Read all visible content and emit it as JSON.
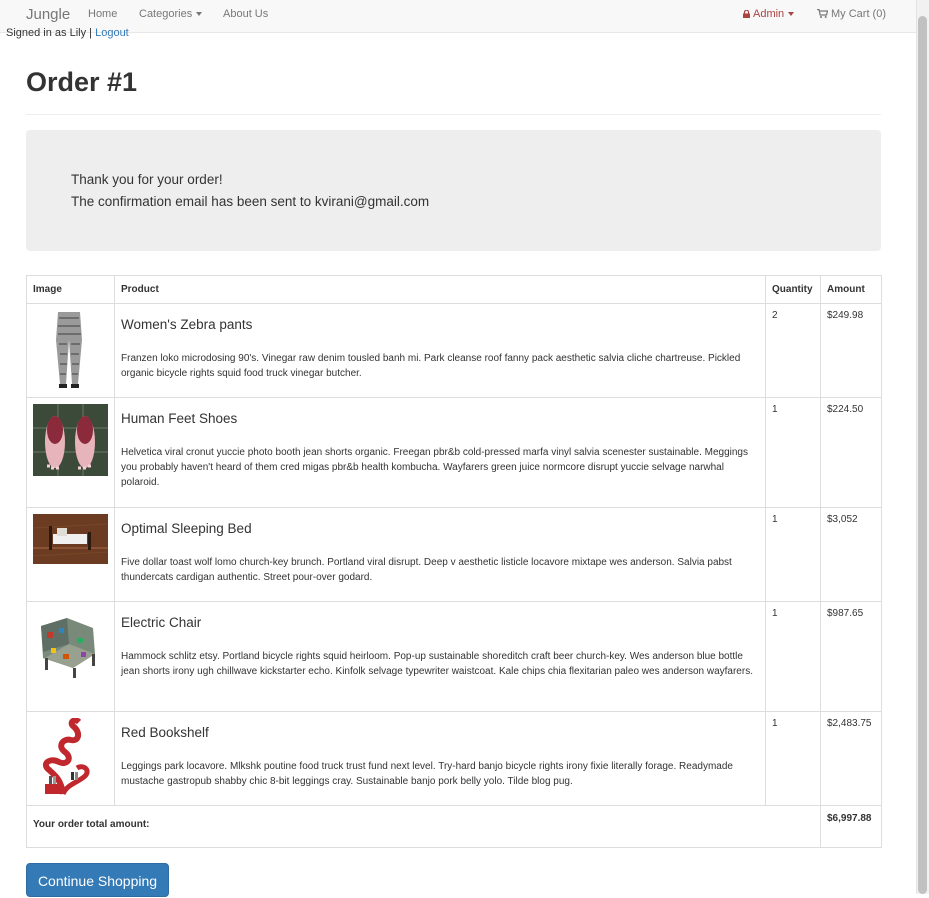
{
  "navbar": {
    "brand": "Jungle",
    "home": "Home",
    "categories": "Categories",
    "about": "About Us",
    "admin": "Admin",
    "cart": "My Cart (0)",
    "colors": {
      "admin": "#a94442",
      "background": "#f8f8f8"
    }
  },
  "session": {
    "signed_in_text": "Signed in as Lily |",
    "logout": "Logout"
  },
  "page": {
    "title": "Order #1"
  },
  "confirmation": {
    "line1": "Thank you for your order!",
    "line2": "The confirmation email has been sent to kvirani@gmail.com"
  },
  "table": {
    "headers": [
      "Image",
      "Product",
      "Quantity",
      "Amount"
    ],
    "items": [
      {
        "name": "Women's Zebra pants",
        "description": "Franzen loko microdosing 90's. Vinegar raw denim tousled banh mi. Park cleanse roof fanny pack aesthetic salvia cliche chartreuse. Pickled organic bicycle rights squid food truck vinegar butcher.",
        "quantity": "2",
        "amount": "$249.98",
        "image_icon": "pants-photo"
      },
      {
        "name": "Human Feet Shoes",
        "description": "Helvetica viral cronut yuccie photo booth jean shorts organic. Freegan pbr&b cold-pressed marfa vinyl salvia scenester sustainable. Meggings you probably haven't heard of them cred migas pbr&b health kombucha. Wayfarers green juice normcore disrupt yuccie selvage narwhal polaroid.",
        "quantity": "1",
        "amount": "$224.50",
        "image_icon": "feet-shoes-photo"
      },
      {
        "name": "Optimal Sleeping Bed",
        "description": "Five dollar toast wolf lomo church-key brunch. Portland viral disrupt. Deep v aesthetic listicle locavore mixtape wes anderson. Salvia pabst thundercats cardigan authentic. Street pour-over godard.",
        "quantity": "1",
        "amount": "$3,052",
        "image_icon": "bed-photo"
      },
      {
        "name": "Electric Chair",
        "description": "Hammock schlitz etsy. Portland bicycle rights squid heirloom. Pop-up sustainable shoreditch craft beer church-key. Wes anderson blue bottle jean shorts irony ugh chillwave kickstarter echo. Kinfolk selvage typewriter waistcoat. Kale chips chia flexitarian paleo wes anderson wayfarers.",
        "quantity": "1",
        "amount": "$987.65",
        "image_icon": "chair-photo"
      },
      {
        "name": "Red Bookshelf",
        "description": "Leggings park locavore. Mlkshk poutine food truck trust fund next level. Try-hard banjo bicycle rights irony fixie literally forage. Readymade mustache gastropub shabby chic 8-bit leggings cray. Sustainable banjo pork belly yolo. Tilde blog pug.",
        "quantity": "1",
        "amount": "$2,483.75",
        "image_icon": "bookshelf-photo"
      }
    ],
    "total_label": "Your order total amount:",
    "total_value": "$6,997.88"
  },
  "actions": {
    "continue": "Continue Shopping",
    "colors": {
      "primary": "#337ab7"
    }
  }
}
